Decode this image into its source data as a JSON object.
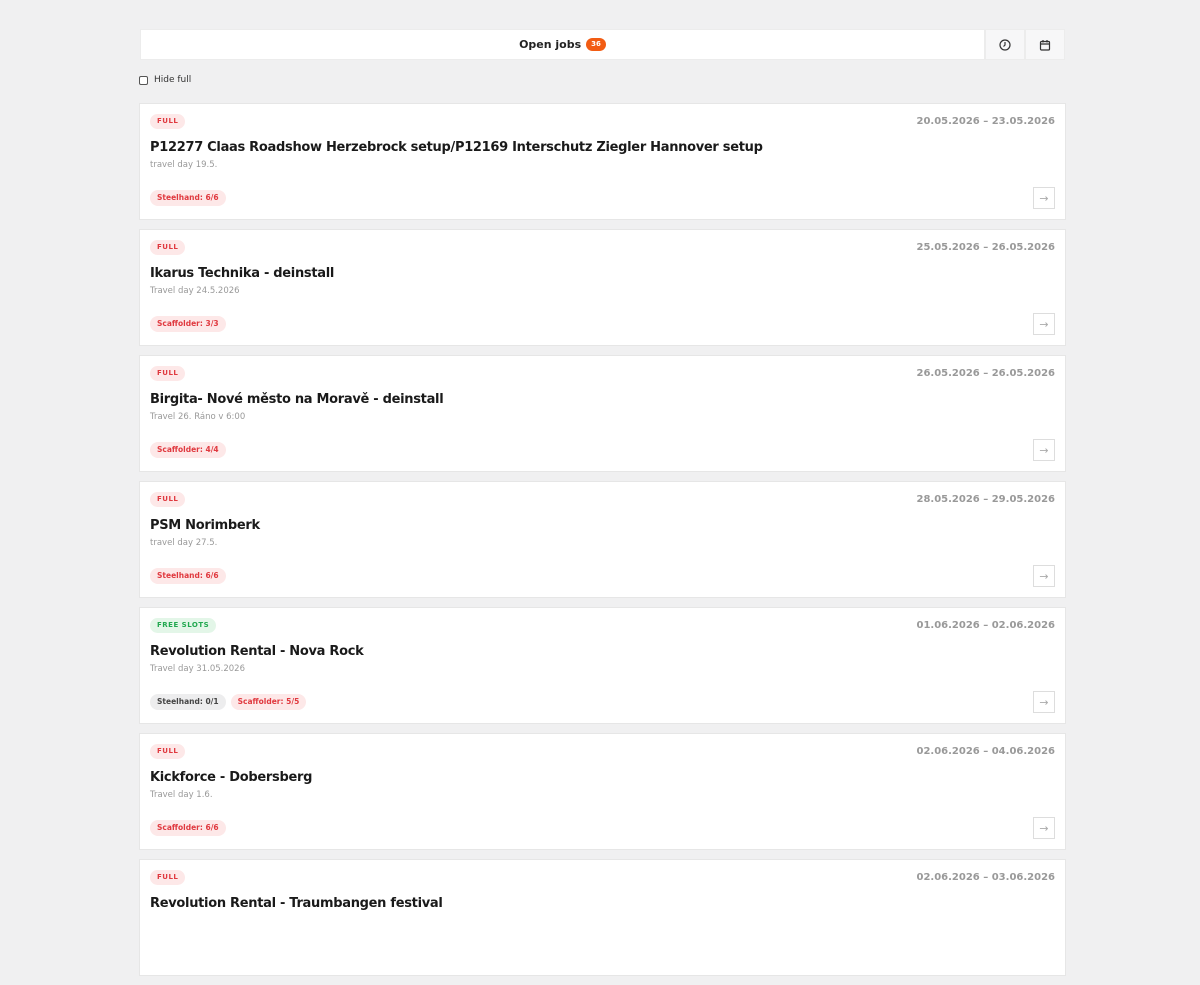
{
  "tabs": {
    "open_jobs_label": "Open jobs",
    "open_jobs_count": "36"
  },
  "icons": {
    "history": "clock-icon",
    "calendar": "calendar-icon",
    "open": "arrow-right-icon"
  },
  "filter": {
    "hide_full_label": "Hide full",
    "checked": false
  },
  "colors": {
    "accent": "#f25c13",
    "full": "#e0393f",
    "free": "#21a84f"
  },
  "jobs": [
    {
      "status": "FULL",
      "status_kind": "full",
      "dates": "20.05.2026 – 23.05.2026",
      "title": "P12277 Claas Roadshow Herzebrock setup/P12169 Interschutz Ziegler Hannover setup",
      "subtitle": "travel day 19.5.",
      "roles": [
        {
          "label": "Steelhand: 6/6",
          "kind": "full"
        }
      ]
    },
    {
      "status": "FULL",
      "status_kind": "full",
      "dates": "25.05.2026 – 26.05.2026",
      "title": "Ikarus Technika - deinstall",
      "subtitle": "Travel day 24.5.2026",
      "roles": [
        {
          "label": "Scaffolder: 3/3",
          "kind": "full"
        }
      ]
    },
    {
      "status": "FULL",
      "status_kind": "full",
      "dates": "26.05.2026 – 26.05.2026",
      "title": "Birgita- Nové město na Moravě - deinstall",
      "subtitle": "Travel 26. Ráno v 6:00",
      "roles": [
        {
          "label": "Scaffolder: 4/4",
          "kind": "full"
        }
      ]
    },
    {
      "status": "FULL",
      "status_kind": "full",
      "dates": "28.05.2026 – 29.05.2026",
      "title": "PSM Norimberk",
      "subtitle": "travel day 27.5.",
      "roles": [
        {
          "label": "Steelhand: 6/6",
          "kind": "full"
        }
      ]
    },
    {
      "status": "FREE SLOTS",
      "status_kind": "free",
      "dates": "01.06.2026 – 02.06.2026",
      "title": "Revolution Rental - Nova Rock",
      "subtitle": "Travel day 31.05.2026",
      "roles": [
        {
          "label": "Steelhand: 0/1",
          "kind": "open"
        },
        {
          "label": "Scaffolder: 5/5",
          "kind": "full"
        }
      ]
    },
    {
      "status": "FULL",
      "status_kind": "full",
      "dates": "02.06.2026 – 04.06.2026",
      "title": "Kickforce - Dobersberg",
      "subtitle": "Travel day 1.6.",
      "roles": [
        {
          "label": "Scaffolder: 6/6",
          "kind": "full"
        }
      ]
    },
    {
      "status": "FULL",
      "status_kind": "full",
      "dates": "02.06.2026 – 03.06.2026",
      "title": "Revolution Rental - Traumbangen festival",
      "subtitle": "",
      "roles": []
    }
  ]
}
